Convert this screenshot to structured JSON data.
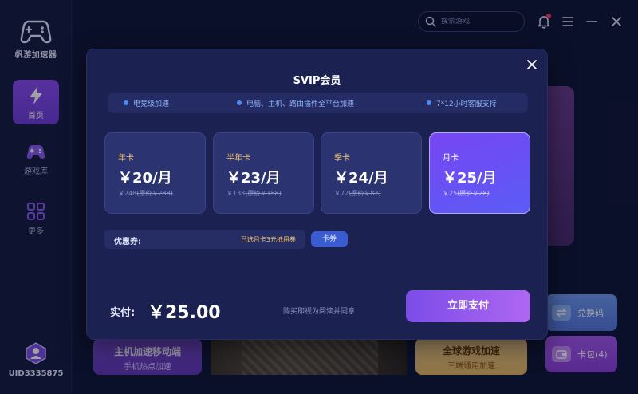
{
  "app": {
    "name": "帆游加速器"
  },
  "sidebar": {
    "items": [
      {
        "label": "首页",
        "icon": "lightning-icon",
        "active": true
      },
      {
        "label": "游戏库",
        "icon": "gamepad-icon",
        "active": false
      },
      {
        "label": "更多",
        "icon": "grid-icon",
        "active": false
      }
    ],
    "uid": "UID3335875"
  },
  "topbar": {
    "search_placeholder": "搜索游戏"
  },
  "background": {
    "mobile_card": {
      "title": "主机加速移动端",
      "subtitle": "手机热点加速"
    },
    "global_card": {
      "title": "全球游戏加速",
      "subtitle": "三端通用加速"
    },
    "redeem_label": "兑换码",
    "wallet_label": "卡包(4)"
  },
  "modal": {
    "title": "SVIP会员",
    "features": [
      "电竞级加速",
      "电脑、主机、路由插件全平台加速",
      "7*12小时客服支持"
    ],
    "plans": [
      {
        "name": "年卡",
        "price": "￥20/月",
        "total": "￥248",
        "original": "(原价￥288)",
        "selected": false
      },
      {
        "name": "半年卡",
        "price": "￥23/月",
        "total": "￥138",
        "original": "(原价￥158)",
        "selected": false
      },
      {
        "name": "季卡",
        "price": "￥24/月",
        "total": "￥72",
        "original": "(原价￥82)",
        "selected": false
      },
      {
        "name": "月卡",
        "price": "￥25/月",
        "total": "￥25",
        "original": "(原价￥28)",
        "selected": true
      }
    ],
    "coupon": {
      "label": "优惠券:",
      "value": "已选月卡3元抵用券",
      "button": "卡券"
    },
    "payment": {
      "label": "实付:",
      "amount": "￥25.00",
      "agreement": "购买即视为阅读并同意",
      "button": "立即支付"
    }
  },
  "colors": {
    "accent": "#7b4ce8",
    "gold": "#f2c46d",
    "bg": "#101536",
    "modal_bg": "#1b2150"
  }
}
